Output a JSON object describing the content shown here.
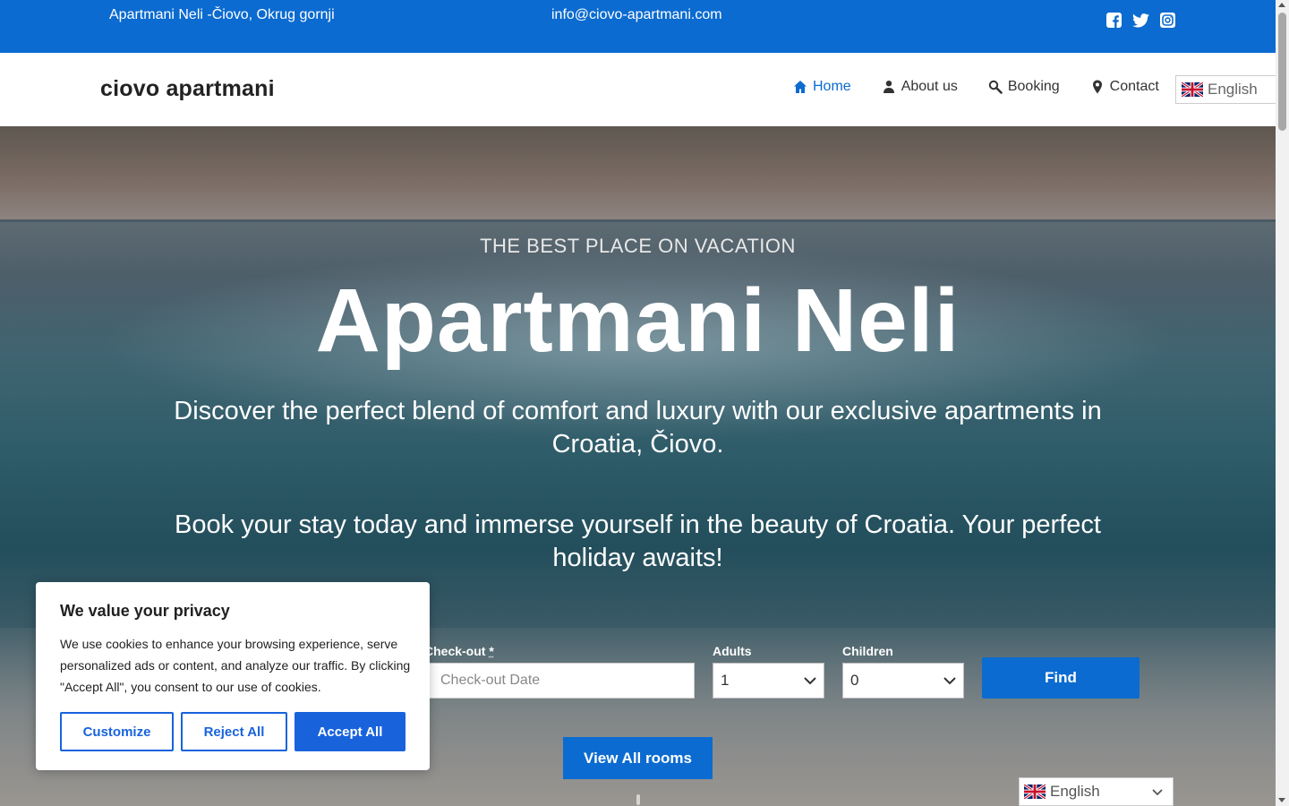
{
  "topbar": {
    "address": "Apartmani Neli -Čiovo, Okrug gornji",
    "email": "info@ciovo-apartmani.com",
    "social_icons": [
      "facebook-icon",
      "twitter-icon",
      "instagram-icon"
    ]
  },
  "header": {
    "logo": "ciovo apartmani",
    "nav": [
      {
        "label": "Home",
        "icon": "home-icon",
        "active": true
      },
      {
        "label": "About us",
        "icon": "user-icon",
        "active": false
      },
      {
        "label": "Booking",
        "icon": "search-icon",
        "active": false
      },
      {
        "label": "Contact",
        "icon": "map-pin-icon",
        "active": false
      }
    ],
    "language": "English"
  },
  "hero": {
    "eyebrow": "THE BEST PLACE ON VACATION",
    "title": "Apartmani Neli",
    "lead1": "Discover the perfect blend of comfort and luxury with our exclusive apartments in Croatia, Čiovo.",
    "lead2": "Book your stay today and immerse yourself in the beauty of Croatia. Your perfect holiday awaits!"
  },
  "search": {
    "checkout_label": "Check-out",
    "required_mark": "*",
    "checkout_placeholder": "Check-out Date",
    "adults_label": "Adults",
    "adults_value": "1",
    "children_label": "Children",
    "children_value": "0",
    "find_label": "Find",
    "view_rooms_label": "View All rooms"
  },
  "cookie": {
    "title": "We value your privacy",
    "text": "We use cookies to enhance your browsing experience, serve personalized ads or content, and analyze our traffic. By clicking \"Accept All\", you consent to our use of cookies.",
    "customize": "Customize",
    "reject": "Reject All",
    "accept": "Accept All"
  },
  "language_switcher": {
    "label": "English"
  },
  "colors": {
    "primary": "#0b6bd0",
    "cookie_accent": "#1863dc"
  }
}
